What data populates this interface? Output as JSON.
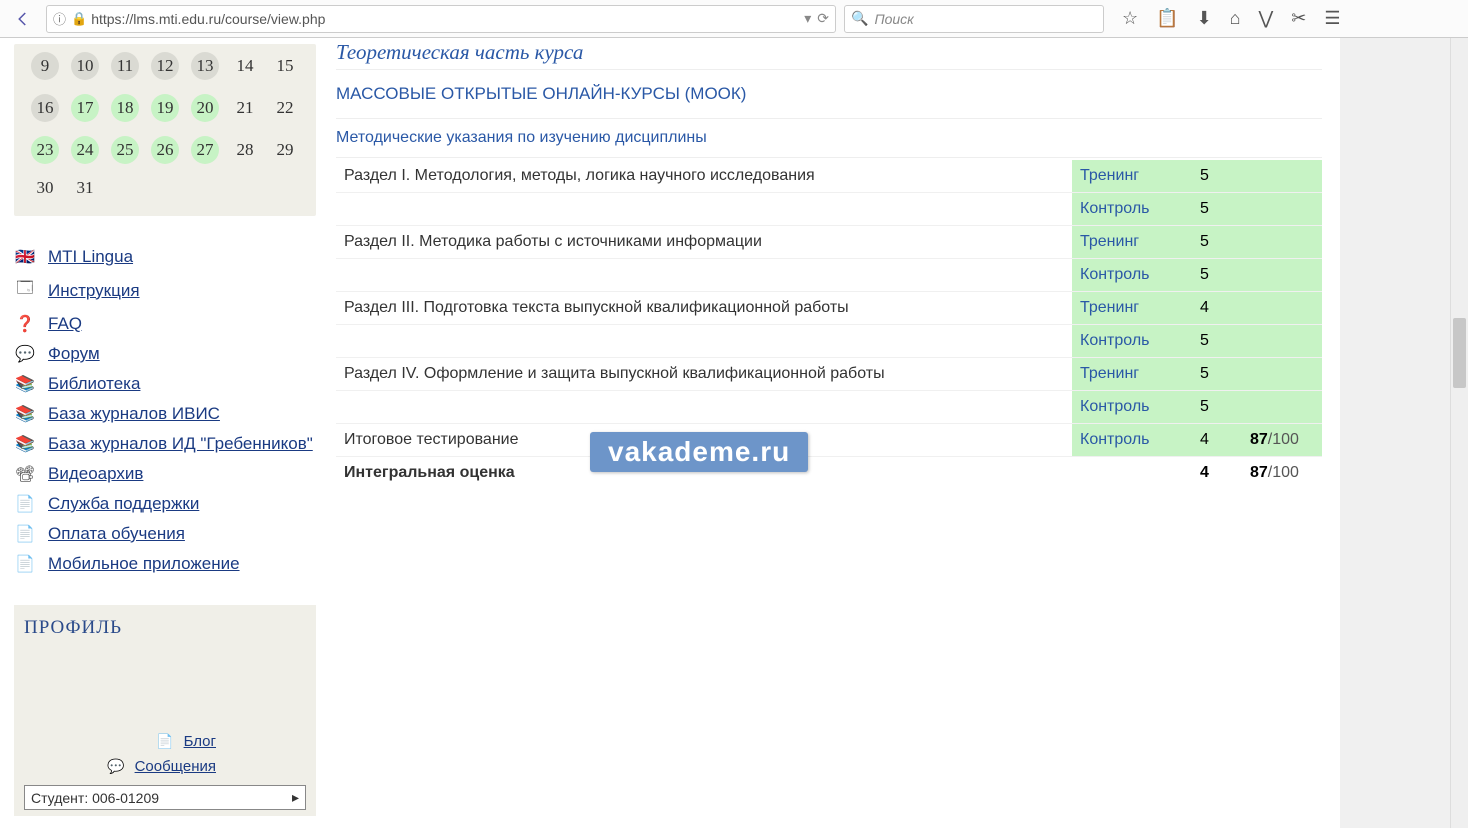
{
  "browser": {
    "url": "https://lms.mti.edu.ru/course/view.php",
    "search_placeholder": "Поиск"
  },
  "calendar": {
    "rows": [
      [
        {
          "d": "9",
          "s": "gray"
        },
        {
          "d": "10",
          "s": "gray"
        },
        {
          "d": "11",
          "s": "gray"
        },
        {
          "d": "12",
          "s": "gray"
        },
        {
          "d": "13",
          "s": "gray"
        },
        {
          "d": "14",
          "s": ""
        },
        {
          "d": "15",
          "s": ""
        }
      ],
      [
        {
          "d": "16",
          "s": "gray"
        },
        {
          "d": "17",
          "s": "green"
        },
        {
          "d": "18",
          "s": "green"
        },
        {
          "d": "19",
          "s": "green"
        },
        {
          "d": "20",
          "s": "green"
        },
        {
          "d": "21",
          "s": ""
        },
        {
          "d": "22",
          "s": ""
        }
      ],
      [
        {
          "d": "23",
          "s": "green"
        },
        {
          "d": "24",
          "s": "green"
        },
        {
          "d": "25",
          "s": "green"
        },
        {
          "d": "26",
          "s": "green"
        },
        {
          "d": "27",
          "s": "green"
        },
        {
          "d": "28",
          "s": ""
        },
        {
          "d": "29",
          "s": ""
        }
      ],
      [
        {
          "d": "30",
          "s": ""
        },
        {
          "d": "31",
          "s": ""
        },
        {
          "d": "",
          "s": ""
        },
        {
          "d": "",
          "s": ""
        },
        {
          "d": "",
          "s": ""
        },
        {
          "d": "",
          "s": ""
        },
        {
          "d": "",
          "s": ""
        }
      ]
    ]
  },
  "sidebar_links": [
    {
      "icon": "flag",
      "label": "MTI Lingua"
    },
    {
      "icon": "window",
      "label": "Инструкция"
    },
    {
      "icon": "question",
      "label": "FAQ"
    },
    {
      "icon": "speech",
      "label": "Форум"
    },
    {
      "icon": "books",
      "label": "Библиотека"
    },
    {
      "icon": "books",
      "label": "База журналов ИВИС"
    },
    {
      "icon": "books",
      "label": "База журналов ИД \"Гребенников\""
    },
    {
      "icon": "camera",
      "label": "Видеоархив"
    },
    {
      "icon": "doc",
      "label": "Служба поддержки"
    },
    {
      "icon": "doc",
      "label": "Оплата обучения"
    },
    {
      "icon": "doc",
      "label": "Мобильное приложение"
    }
  ],
  "profile": {
    "title": "ПРОФИЛЬ",
    "links": [
      {
        "icon": "doc",
        "label": "Блог"
      },
      {
        "icon": "speech",
        "label": "Сообщения"
      }
    ],
    "student_label": "Студент: 006-01209"
  },
  "main": {
    "theoretical": "Теоретическая часть курса",
    "mooc": "МАССОВЫЕ ОТКРЫТЫЕ ОНЛАЙН-КУРСЫ (МООК)",
    "method": "Методические указания по изучению дисциплины",
    "rows": [
      {
        "section": "Раздел I. Методология, методы, логика научного исследования",
        "activity": "Тренинг",
        "score": "5",
        "extra": "",
        "extra2": ""
      },
      {
        "section": "",
        "activity": "Контроль",
        "score": "5",
        "extra": "",
        "extra2": ""
      },
      {
        "section": "Раздел II. Методика работы с источниками информации",
        "activity": "Тренинг",
        "score": "5",
        "extra": "",
        "extra2": ""
      },
      {
        "section": "",
        "activity": "Контроль",
        "score": "5",
        "extra": "",
        "extra2": ""
      },
      {
        "section": "Раздел III. Подготовка текста выпускной квалификационной работы",
        "activity": "Тренинг",
        "score": "4",
        "extra": "",
        "extra2": ""
      },
      {
        "section": "",
        "activity": "Контроль",
        "score": "5",
        "extra": "",
        "extra2": ""
      },
      {
        "section": "Раздел IV. Оформление и защита выпускной квалификационной работы",
        "activity": "Тренинг",
        "score": "5",
        "extra": "",
        "extra2": ""
      },
      {
        "section": "",
        "activity": "Контроль",
        "score": "5",
        "extra": "",
        "extra2": ""
      },
      {
        "section": "Итоговое тестирование",
        "activity": "Контроль",
        "score": "4",
        "extra": "87",
        "extra2": "/100"
      },
      {
        "section": "Интегральная оценка",
        "activity": "",
        "score": "4",
        "extra": "87",
        "extra2": "/100",
        "bold": true
      }
    ]
  },
  "watermark": "vakademe.ru"
}
